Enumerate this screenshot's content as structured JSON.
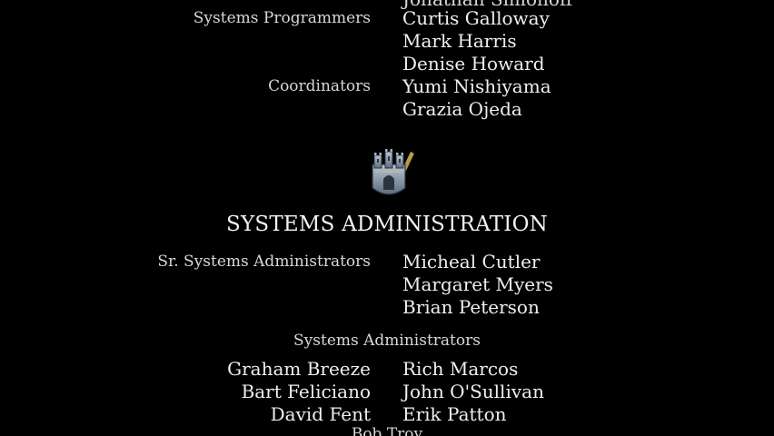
{
  "credits_top": {
    "cut_name": "Jonathan Simonoff",
    "systems_programmers_role": "Systems Programmers",
    "systems_programmers": [
      "Curtis Galloway",
      "Mark Harris",
      "Denise Howard"
    ],
    "coordinators_role": "Coordinators",
    "coordinators": [
      "Yumi Nishiyama",
      "Grazia Ojeda"
    ]
  },
  "emblem": {
    "icon": "castle-crest-icon",
    "colors": {
      "stone": "#8fa0b5",
      "gold": "#c9a24a",
      "dark": "#2b3340"
    }
  },
  "systems_administration": {
    "heading": "SYSTEMS ADMINISTRATION",
    "sr_role": "Sr. Systems Administrators",
    "sr_names": [
      "Micheal Cutler",
      "Margaret Myers",
      "Brian Peterson"
    ],
    "sub_heading": "Systems Administrators",
    "left_names": [
      "Graham Breeze",
      "Bart Feliciano",
      "David Fent"
    ],
    "right_names": [
      "Rich Marcos",
      "John O'Sullivan",
      "Erik Patton"
    ],
    "cut_bottom_name": "Bob Troy"
  }
}
